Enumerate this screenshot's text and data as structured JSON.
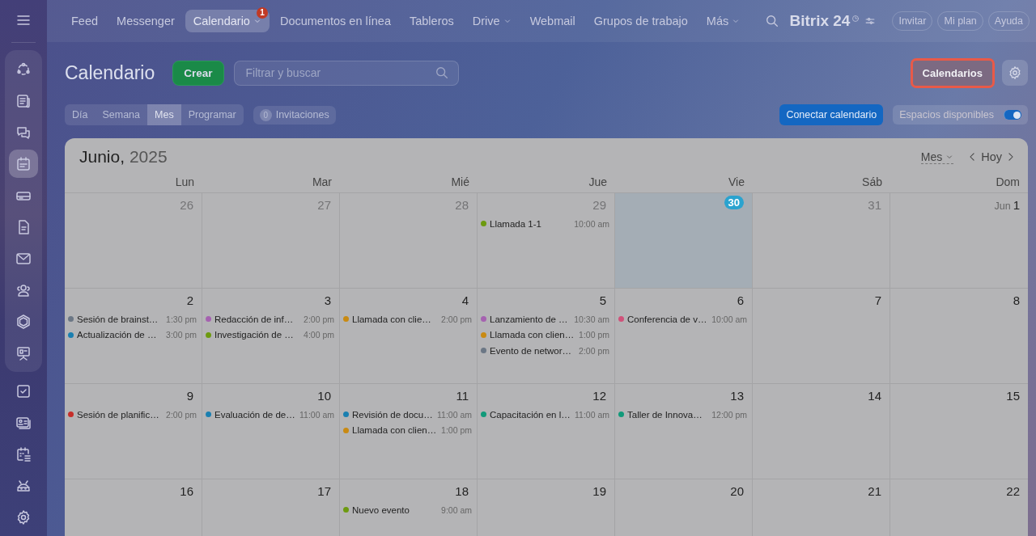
{
  "sidebar": {
    "items": [
      {
        "selected": false
      },
      {
        "selected": false
      },
      {
        "selected": false
      },
      {
        "selected": true
      },
      {
        "selected": false
      },
      {
        "selected": false
      },
      {
        "selected": false
      },
      {
        "selected": false
      },
      {
        "selected": false
      },
      {
        "selected": false
      },
      {
        "selected": false
      },
      {
        "selected": false
      },
      {
        "selected": false
      },
      {
        "selected": false
      },
      {
        "selected": false
      }
    ]
  },
  "nav": {
    "items": [
      {
        "label": "Feed",
        "selected": false,
        "caret": false
      },
      {
        "label": "Messenger",
        "selected": false,
        "caret": false
      },
      {
        "label": "Calendario",
        "selected": true,
        "caret": true,
        "badge": "1"
      },
      {
        "label": "Documentos en línea",
        "selected": false,
        "caret": false
      },
      {
        "label": "Tableros",
        "selected": false,
        "caret": false
      },
      {
        "label": "Drive",
        "selected": false,
        "caret": true
      },
      {
        "label": "Webmail",
        "selected": false,
        "caret": false
      },
      {
        "label": "Grupos de trabajo",
        "selected": false,
        "caret": false
      },
      {
        "label": "Más",
        "selected": false,
        "caret": true
      }
    ],
    "logo": "Bitrix 24",
    "buttons": [
      "Invitar",
      "Mi plan",
      "Ayuda"
    ]
  },
  "toolbar": {
    "title": "Calendario",
    "create_button": "Crear",
    "search": {
      "placeholder": "Filtrar y buscar"
    },
    "calendars_button": {
      "label": "Calendarios",
      "highlighted": true
    },
    "views": [
      {
        "label": "Día",
        "selected": false
      },
      {
        "label": "Semana",
        "selected": false
      },
      {
        "label": "Mes",
        "selected": true
      },
      {
        "label": "Programar",
        "selected": false
      }
    ],
    "invitations": {
      "count": "0",
      "label": "Invitaciones"
    },
    "connect_button": "Conectar calendario",
    "free_slots": {
      "label": "Espacios disponibles",
      "on": true
    }
  },
  "calendar": {
    "month": "Junio,",
    "year": "2025",
    "view_select": "Mes",
    "today_button": "Hoy",
    "weekdays": [
      "Lun",
      "Mar",
      "Mié",
      "Jue",
      "Vie",
      "Sáb",
      "Dom"
    ],
    "weeks": [
      [
        {
          "day": "26",
          "other_month": true,
          "today": false
        },
        {
          "day": "27",
          "other_month": true,
          "today": false
        },
        {
          "day": "28",
          "other_month": true,
          "today": false
        },
        {
          "day": "29",
          "other_month": true,
          "today": false,
          "events": [
            {
              "title": "Llamada 1-1",
              "time": "10:00 am",
              "color": "#6d9a10"
            }
          ]
        },
        {
          "day": "30",
          "today": true
        },
        {
          "day": "31",
          "other_month": true,
          "today": false
        },
        {
          "day": "1",
          "month_prefix": "Jun",
          "other_month": false,
          "today": false
        }
      ],
      [
        {
          "day": "2",
          "other_month": false,
          "today": false,
          "events": [
            {
              "title": "Sesión de brainst…",
              "time": "1:30 pm",
              "color": "#6b7785"
            },
            {
              "title": "Actualización de …",
              "time": "3:00 pm",
              "color": "#1a7fb0"
            }
          ]
        },
        {
          "day": "3",
          "other_month": false,
          "today": false,
          "events": [
            {
              "title": "Redacción de inf…",
              "time": "2:00 pm",
              "color": "#a561b0"
            },
            {
              "title": "Investigación de …",
              "time": "4:00 pm",
              "color": "#6d9a10"
            }
          ]
        },
        {
          "day": "4",
          "other_month": false,
          "today": false,
          "events": [
            {
              "title": "Llamada con clie…",
              "time": "2:00 pm",
              "color": "#c98a12"
            }
          ]
        },
        {
          "day": "5",
          "other_month": false,
          "today": false,
          "events": [
            {
              "title": "Lanzamiento de …",
              "time": "10:30 am",
              "color": "#a561b0"
            },
            {
              "title": "Llamada con clien…",
              "time": "1:00 pm",
              "color": "#c98a12"
            },
            {
              "title": "Evento de networ…",
              "time": "2:00 pm",
              "color": "#6b7785"
            }
          ]
        },
        {
          "day": "6",
          "other_month": false,
          "today": false,
          "events": [
            {
              "title": "Conferencia de v…",
              "time": "10:00 am",
              "color": "#d0527a"
            }
          ]
        },
        {
          "day": "7",
          "other_month": false,
          "today": false
        },
        {
          "day": "8",
          "other_month": false,
          "today": false
        }
      ],
      [
        {
          "day": "9",
          "other_month": false,
          "today": false,
          "events": [
            {
              "title": "Sesión de planific…",
              "time": "2:00 pm",
              "color": "#c62e2a"
            }
          ]
        },
        {
          "day": "10",
          "other_month": false,
          "today": false,
          "events": [
            {
              "title": "Evaluación de de…",
              "time": "11:00 am",
              "color": "#1a7fb0"
            }
          ]
        },
        {
          "day": "11",
          "other_month": false,
          "today": false,
          "events": [
            {
              "title": "Revisión de docu…",
              "time": "11:00 am",
              "color": "#1a7fb0"
            },
            {
              "title": "Llamada con clien…",
              "time": "1:00 pm",
              "color": "#c98a12"
            }
          ]
        },
        {
          "day": "12",
          "other_month": false,
          "today": false,
          "events": [
            {
              "title": "Capacitación en l…",
              "time": "11:00 am",
              "color": "#119a7a"
            }
          ]
        },
        {
          "day": "13",
          "other_month": false,
          "today": false,
          "events": [
            {
              "title": "Taller de Innova…",
              "time": "12:00 pm",
              "color": "#119a7a"
            }
          ]
        },
        {
          "day": "14",
          "other_month": false,
          "today": false
        },
        {
          "day": "15",
          "other_month": false,
          "today": false
        }
      ],
      [
        {
          "day": "16",
          "other_month": false,
          "today": false
        },
        {
          "day": "17",
          "other_month": false,
          "today": false
        },
        {
          "day": "18",
          "other_month": false,
          "today": false,
          "events": [
            {
              "title": "Nuevo evento",
              "time": "9:00 am",
              "color": "#6d9a10"
            }
          ]
        },
        {
          "day": "19",
          "other_month": false,
          "today": false
        },
        {
          "day": "20",
          "other_month": false,
          "today": false
        },
        {
          "day": "21",
          "other_month": false,
          "today": false
        },
        {
          "day": "22",
          "other_month": false,
          "today": false
        }
      ]
    ]
  }
}
